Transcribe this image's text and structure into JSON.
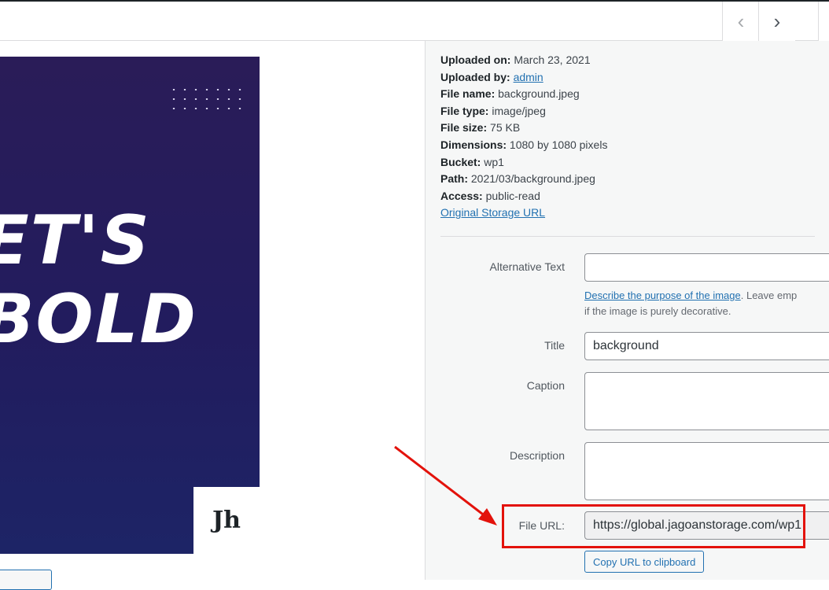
{
  "nav": {
    "prev_icon": "‹",
    "next_icon": "›"
  },
  "media": {
    "headline": "ET'S\nBOLD",
    "logo_text": "Jh"
  },
  "details": {
    "meta": [
      {
        "label": "Uploaded on:",
        "value": "March 23, 2021"
      },
      {
        "label": "Uploaded by:",
        "value": "admin",
        "link": true
      },
      {
        "label": "File name:",
        "value": "background.jpeg"
      },
      {
        "label": "File type:",
        "value": "image/jpeg"
      },
      {
        "label": "File size:",
        "value": "75 KB"
      },
      {
        "label": "Dimensions:",
        "value": "1080 by 1080 pixels"
      },
      {
        "label": "Bucket:",
        "value": "wp1"
      },
      {
        "label": "Path:",
        "value": "2021/03/background.jpeg"
      },
      {
        "label": "Access:",
        "value": "public-read"
      }
    ],
    "original_storage_link": "Original Storage URL",
    "fields": {
      "alt_label": "Alternative Text",
      "alt_value": "",
      "alt_help_link": "Describe the purpose of the image",
      "alt_help_rest": ". Leave emp",
      "alt_help_line2": "if the image is purely decorative.",
      "title_label": "Title",
      "title_value": "background",
      "caption_label": "Caption",
      "caption_value": "",
      "description_label": "Description",
      "description_value": "",
      "file_url_label": "File URL:",
      "file_url_value": "https://global.jagoanstorage.com/wp1",
      "copy_button": "Copy URL to clipboard"
    }
  },
  "annotation": {
    "color": "#e3120b"
  }
}
